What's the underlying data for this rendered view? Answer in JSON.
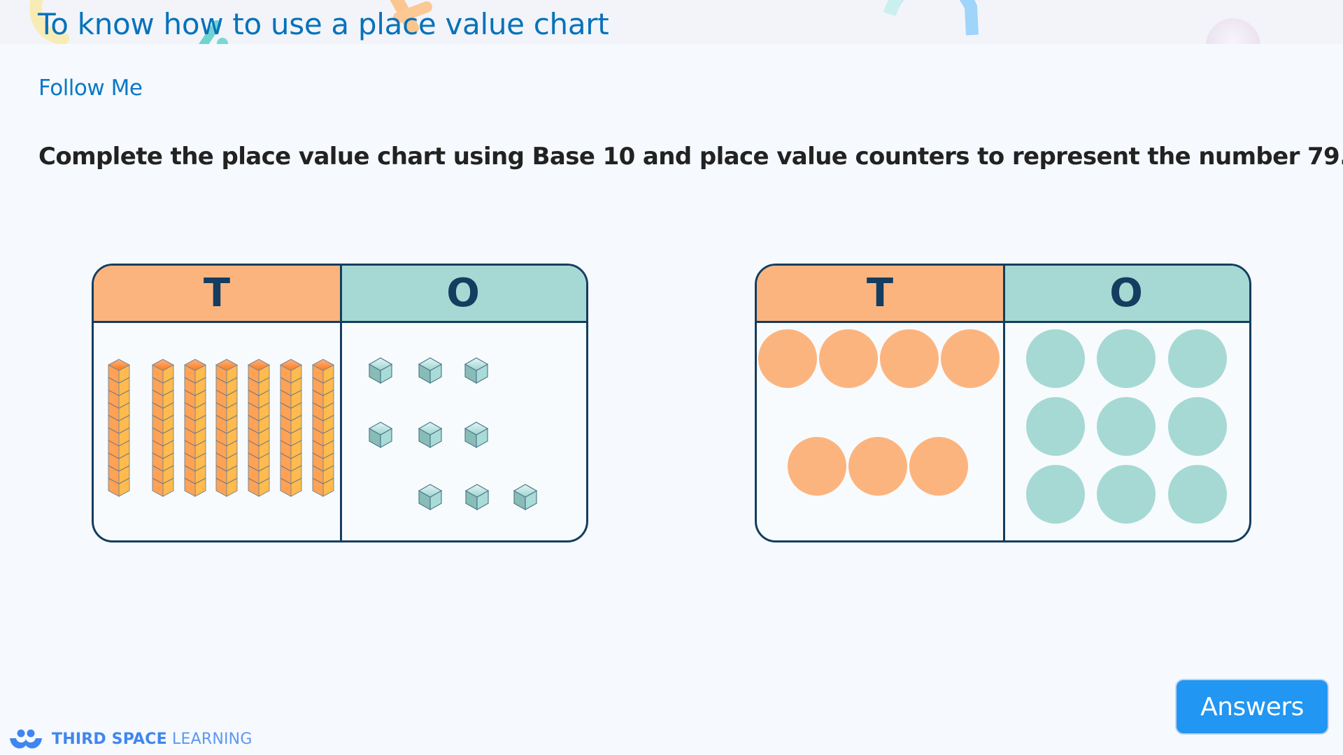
{
  "header": {
    "title": "To know how to use a place value chart"
  },
  "section_label": "Follow Me",
  "question": "Complete the place value chart using Base 10 and place value counters to represent the number 79.",
  "number_represented": 79,
  "charts": [
    {
      "name": "base-10-chart",
      "representation": "Base 10 blocks",
      "columns": [
        {
          "label": "T",
          "place": "tens",
          "count": 7,
          "piece": "ten-rod"
        },
        {
          "label": "O",
          "place": "ones",
          "count": 9,
          "piece": "unit-cube"
        }
      ]
    },
    {
      "name": "counters-chart",
      "representation": "Place value counters",
      "columns": [
        {
          "label": "T",
          "place": "tens",
          "count": 7,
          "piece": "orange-counter"
        },
        {
          "label": "O",
          "place": "ones",
          "count": 9,
          "piece": "teal-counter"
        }
      ]
    }
  ],
  "answers_button": "Answers",
  "brand": {
    "bold": "THIRD SPACE",
    "light": "LEARNING"
  },
  "colors": {
    "title_blue": "#0672bb",
    "tens_orange": "#fcb47f",
    "ones_teal": "#a6d9d4",
    "border_navy": "#143d5f",
    "button_blue": "#2196f3",
    "brand_blue": "#3f86f0"
  }
}
